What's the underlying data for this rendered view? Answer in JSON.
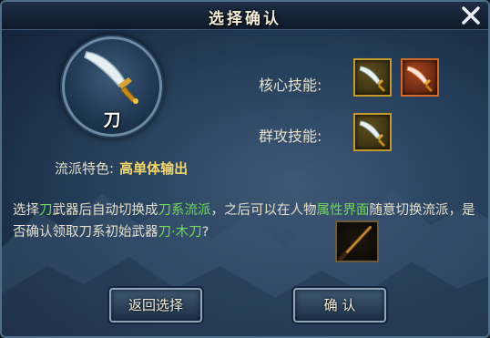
{
  "dialog": {
    "title": "选择确认"
  },
  "emblem": {
    "label": "刀"
  },
  "skills": {
    "core_label": "核心技能:",
    "aoe_label": "群攻技能:"
  },
  "faction": {
    "label": "流派特色:",
    "value": "高单体输出"
  },
  "description": {
    "seg1": "选择",
    "seg2": "刀",
    "seg3": "武器后自动切换成",
    "seg4": "刀系流派",
    "seg5": "，之后可以在人物",
    "seg6": "属性界面",
    "seg7": "随意切换流派，是否确认领取刀系初始武器",
    "seg8": "刀·木刀",
    "seg9": "?"
  },
  "buttons": {
    "back": "返回选择",
    "confirm": "确 认"
  },
  "colors": {
    "highlight": "#6fd95a",
    "faction_value": "#f3d76a",
    "gold_border": "#c49a2c"
  }
}
